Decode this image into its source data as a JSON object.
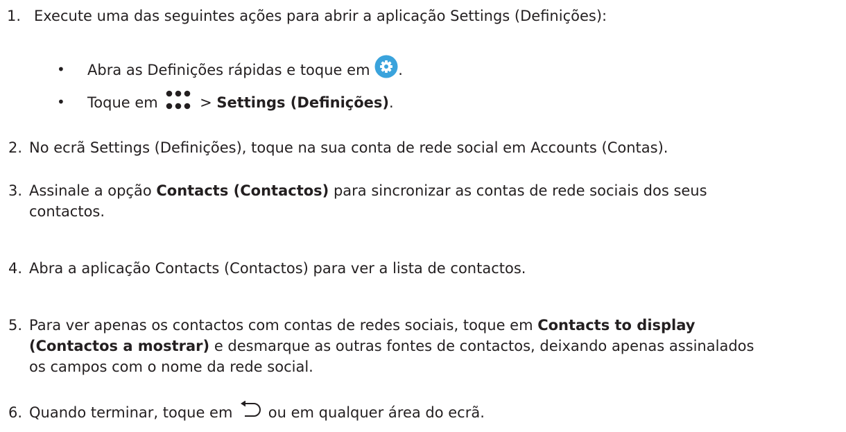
{
  "steps": [
    {
      "num": "1.",
      "text": "Execute uma das seguintes ações para abrir a aplicação Settings (Definições):"
    },
    {
      "num": "2.",
      "text": "No ecrã Settings (Definições), toque na sua conta de rede social em Accounts (Contas)."
    },
    {
      "num": "3.",
      "pre": "Assinale a opção ",
      "bold": "Contacts (Contactos)",
      "post": " para sincronizar as contas de rede sociais dos seus",
      "line2": "contactos."
    },
    {
      "num": "4.",
      "text": "Abra a aplicação Contacts (Contactos) para ver a lista de contactos."
    },
    {
      "num": "5.",
      "pre": "Para ver apenas os contactos com contas de redes sociais, toque em ",
      "bold": "Contacts to display",
      "line2_bold": "(Contactos a mostrar)",
      "line2_post": " e desmarque as outras fontes de contactos, deixando apenas assinalados",
      "line3": "os campos com o nome da rede social."
    },
    {
      "num": "6.",
      "pre": "Quando terminar, toque em ",
      "post": " ou em qualquer área do ecrã."
    }
  ],
  "substeps": [
    {
      "bullet": "•",
      "pre": "Abra as Definições rápidas e toque em ",
      "post": ".",
      "icon": "settings-gear-icon"
    },
    {
      "bullet": "•",
      "pre": "Toque em ",
      "mid": " > ",
      "bold": "Settings (Definições)",
      "post": ".",
      "icon": "all-apps-icon"
    }
  ],
  "colors": {
    "text": "#231f20",
    "gear_badge": "#3aa3dc"
  }
}
